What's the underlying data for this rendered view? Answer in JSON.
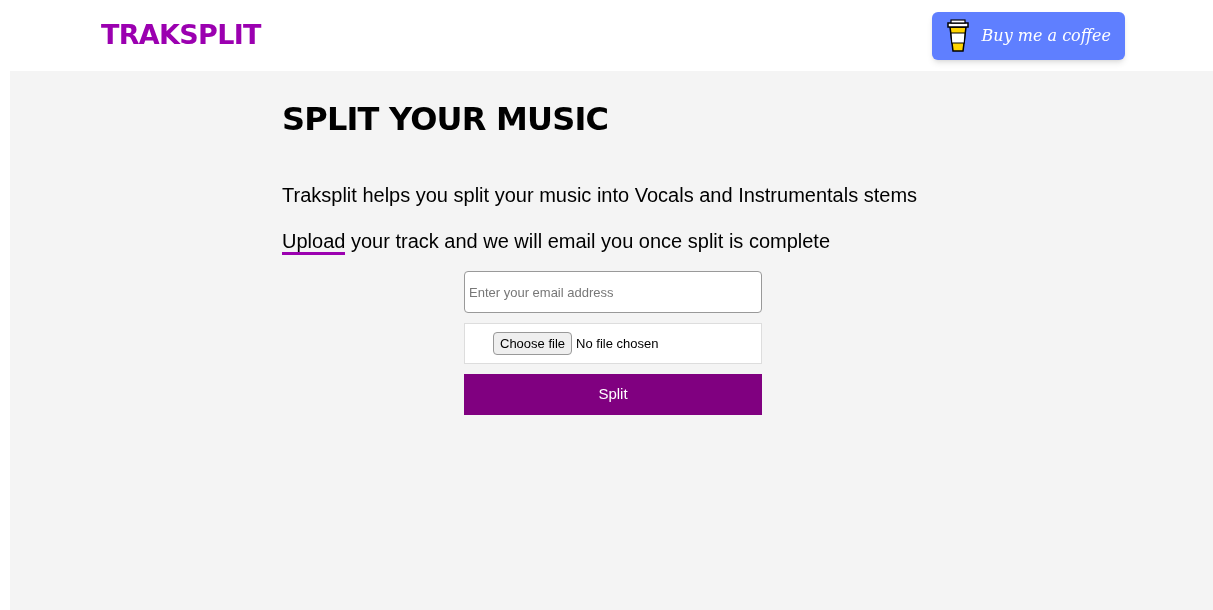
{
  "header": {
    "logo": "TRAKSPLIT",
    "coffee_button": "Buy me a coffee"
  },
  "main": {
    "title": "SPLIT YOUR MUSIC",
    "intro": "Traksplit helps you split your music into Vocals and Instrumentals stems",
    "upload_link": "Upload",
    "upload_rest": " your track and we will email you once split is complete"
  },
  "form": {
    "email": {
      "placeholder": "Enter your email address"
    },
    "file": {
      "button": "Choose file",
      "status": "No file chosen"
    },
    "submit": "Split"
  }
}
